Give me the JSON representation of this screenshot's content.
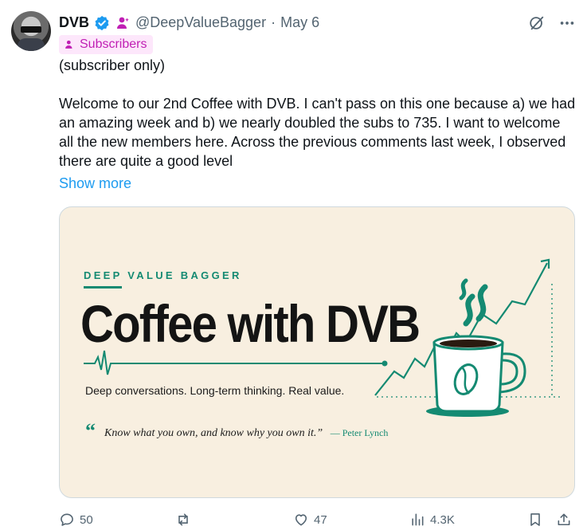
{
  "author": {
    "name": "DVB",
    "handle": "@DeepValueBagger",
    "separator": "·",
    "date": "May 6"
  },
  "badge": {
    "label": "Subscribers"
  },
  "post": {
    "line1": "(subscriber only)",
    "body": "Welcome to our 2nd Coffee with DVB.  I can't pass on this one because a) we had an amazing week and b) we nearly doubled the subs to 735. I want to welcome all the new members here. Across the previous comments last week, I observed there are quite a good level",
    "show_more": "Show more"
  },
  "card": {
    "kicker": "DEEP VALUE BAGGER",
    "title": "Coffee with DVB",
    "subtitle": "Deep conversations. Long-term thinking. Real value.",
    "quote_mark": "“",
    "quote": "Know what you own, and know why you own it.”",
    "attribution": "— Peter Lynch",
    "colors": {
      "accent": "#148a72",
      "background": "#f8efe0"
    }
  },
  "actions": {
    "replies": "50",
    "reposts": "",
    "likes": "47",
    "views": "4.3K"
  },
  "icons": [
    "verified-icon",
    "subscriber-icon",
    "grok-icon",
    "more-icon",
    "reply-icon",
    "repost-icon",
    "like-icon",
    "views-icon",
    "bookmark-icon",
    "share-icon"
  ]
}
